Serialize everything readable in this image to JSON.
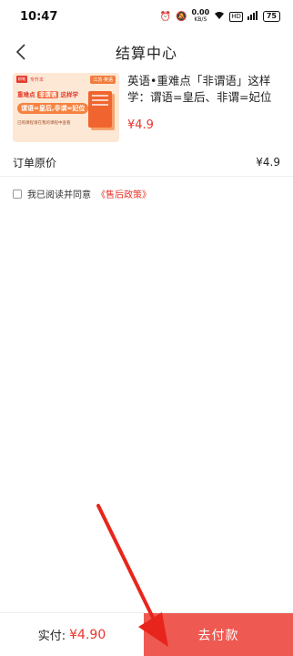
{
  "status_bar": {
    "time": "10:47",
    "net_speed_value": "0.00",
    "net_speed_unit": "KB/S",
    "hd_label": "HD",
    "battery": "75"
  },
  "nav": {
    "title": "结算中心",
    "back_icon": "chevron-left-icon"
  },
  "product": {
    "title": "英语•重难点「非谓语」这样学：谓语=皇后、非谓=妃位",
    "price": "¥4.9",
    "cover": {
      "logo": "粉笔",
      "brand": "专升本",
      "tag": "江苏·英语",
      "line1_prefix": "重难点",
      "line1_highlight": "非谓语",
      "line1_suffix": "这样学",
      "line2": "谓语=皇后,非谓=妃位",
      "line3": "已购课程请在我的课程中查看"
    }
  },
  "order": {
    "label": "订单原价",
    "value": "¥4.9"
  },
  "agreement": {
    "text": "我已阅读并同意",
    "link": "《售后政策》"
  },
  "bottom": {
    "total_label": "实付:",
    "total_amount": "¥4.90",
    "pay_button": "去付款"
  },
  "colors": {
    "accent": "#e8352b",
    "pay_button": "#ee5a52",
    "annotation_arrow": "#e8251c"
  }
}
